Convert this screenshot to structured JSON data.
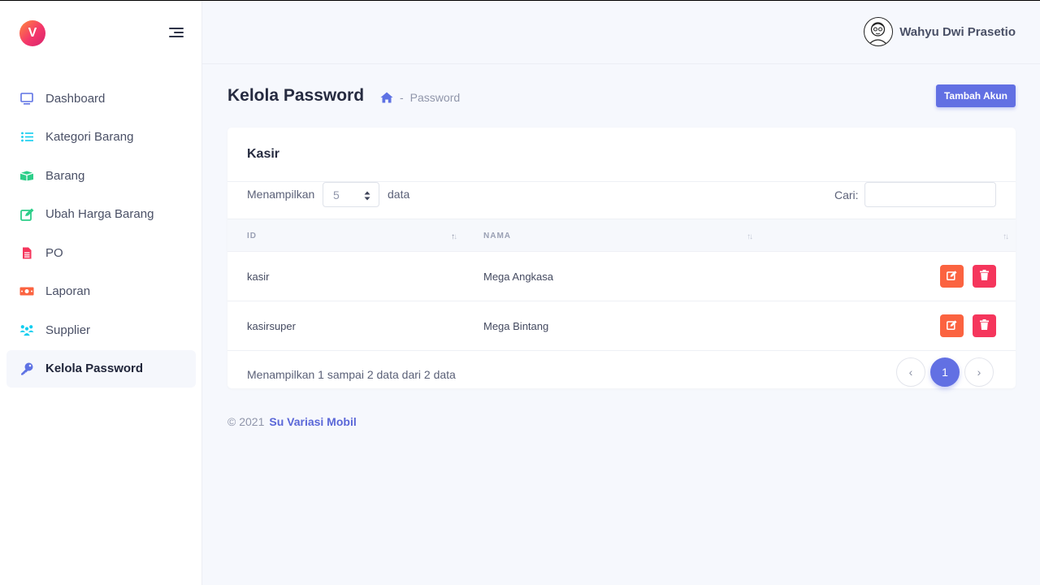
{
  "brand": {
    "logo_letter": "V",
    "accent": "#6270e3"
  },
  "sidebar": {
    "items": [
      {
        "label": "Dashboard",
        "icon": "monitor-icon"
      },
      {
        "label": "Kategori Barang",
        "icon": "list-icon"
      },
      {
        "label": "Barang",
        "icon": "box-icon"
      },
      {
        "label": "Ubah Harga Barang",
        "icon": "edit-icon"
      },
      {
        "label": "PO",
        "icon": "file-icon"
      },
      {
        "label": "Laporan",
        "icon": "money-icon"
      },
      {
        "label": "Supplier",
        "icon": "people-icon"
      },
      {
        "label": "Kelola Password",
        "icon": "key-icon",
        "active": true
      }
    ]
  },
  "topbar": {
    "user_name": "Wahyu Dwi Prasetio"
  },
  "header": {
    "title": "Kelola Password",
    "breadcrumb_sep": "-",
    "breadcrumb_current": "Password",
    "add_button": "Tambah Akun"
  },
  "card": {
    "title": "Kasir",
    "show_label": "Menampilkan",
    "page_size": "5",
    "data_label": "data",
    "search_label": "Cari:",
    "search_value": "",
    "columns": [
      "ID",
      "NAMA"
    ],
    "rows": [
      {
        "id": "kasir",
        "nama": "Mega Angkasa"
      },
      {
        "id": "kasirsuper",
        "nama": "Mega Bintang"
      }
    ],
    "info": "Menampilkan 1 sampai 2 data dari 2 data",
    "pagination": {
      "prev": "‹",
      "current": "1",
      "next": "›"
    }
  },
  "footer": {
    "copyright": "© 2021",
    "brand_link": "Su Variasi Mobil"
  }
}
